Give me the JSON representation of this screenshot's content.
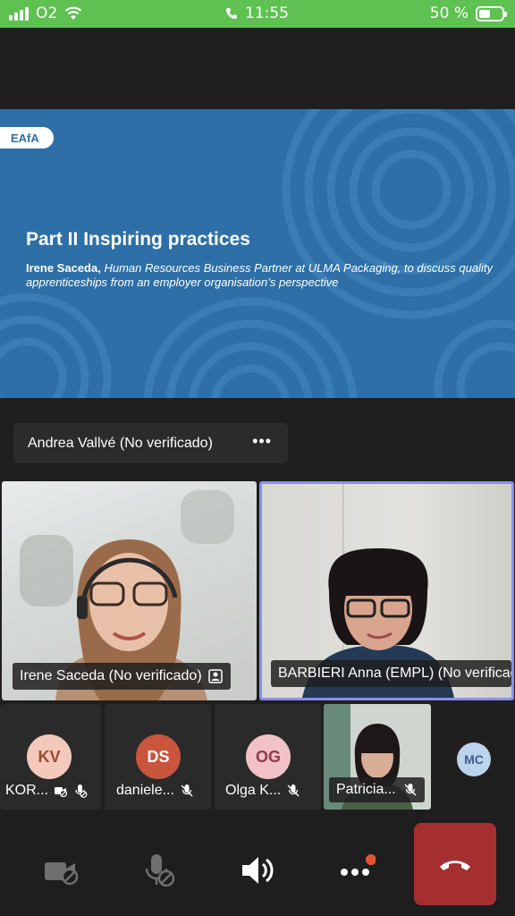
{
  "status_bar": {
    "carrier": "O2",
    "time": "11:55",
    "battery": "50 %",
    "battery_level": 0.5
  },
  "slide": {
    "logo": "EAfA",
    "title": "Part II Inspiring practices",
    "speaker_name": "Irene Saceda,",
    "speaker_desc": "Human Resources Business Partner at ULMA Packaging, to discuss quality apprenticeships from an employer organisation’s perspective",
    "background_color": "#2d6fa6"
  },
  "presenter": {
    "label": "Andrea Vallvé (No verificado)",
    "more": "•••"
  },
  "video_tiles": [
    {
      "name": "Irene Saceda (No verificado)"
    },
    {
      "name": "BARBIERI Anna (EMPL) (No verificado)"
    }
  ],
  "participants": [
    {
      "initials": "KV",
      "name": "KOR...",
      "color": "#f2c9bb",
      "text_color": "#9a4b33"
    },
    {
      "initials": "DS",
      "name": "daniele...",
      "color": "#c9553d",
      "text_color": "#ffffff"
    },
    {
      "initials": "OG",
      "name": "Olga K...",
      "color": "#f1c1c8",
      "text_color": "#8a3d4a"
    },
    {
      "name": "Patricia..."
    },
    {
      "initials": "MC",
      "color": "#bcd3ee",
      "text_color": "#3d5e86"
    }
  ],
  "controls": {
    "camera": "camera-off-icon",
    "mic": "mic-off-icon",
    "speaker": "speaker-icon",
    "more": "more-icon",
    "leave": "hang-up-icon",
    "leave_color": "#a52e2e",
    "notification_color": "#e0572f"
  }
}
